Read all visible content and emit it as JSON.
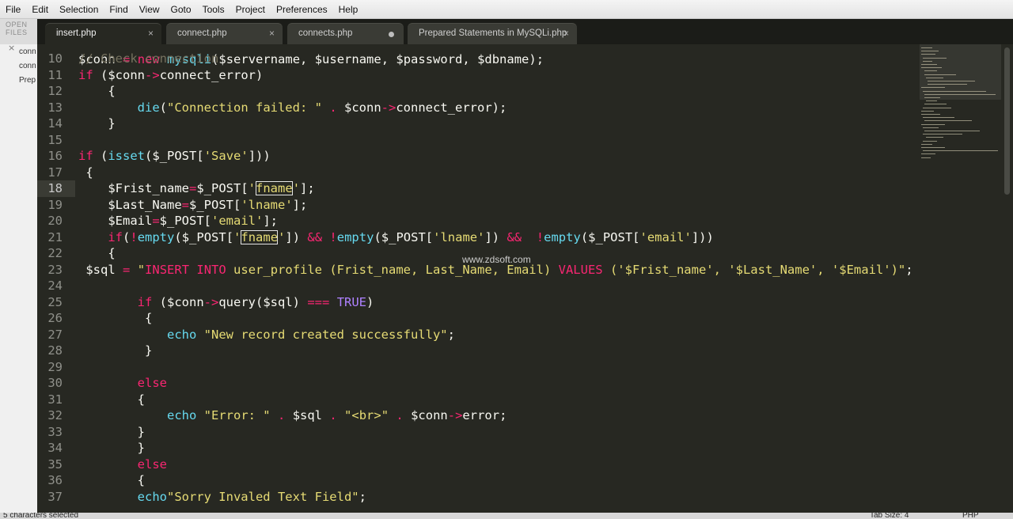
{
  "menu": [
    "File",
    "Edit",
    "Selection",
    "Find",
    "View",
    "Goto",
    "Tools",
    "Project",
    "Preferences",
    "Help"
  ],
  "sidebar": {
    "title": "OPEN FILES",
    "files": [
      "conn",
      "conn",
      "Prep"
    ]
  },
  "tabs": [
    {
      "label": "insert.php",
      "state": "active",
      "icon": "close-icon"
    },
    {
      "label": "connect.php",
      "state": "inactive",
      "icon": "close-icon"
    },
    {
      "label": "connects.php",
      "state": "inactive",
      "icon": "unsaved-dot-icon"
    },
    {
      "label": "Prepared Statements in MySQLi.php",
      "state": "inactive",
      "icon": "close-icon"
    }
  ],
  "editor": {
    "current_line": 18,
    "lines": [
      {
        "n": "10",
        "text": "// Check connection"
      },
      {
        "n": "11",
        "text": "if ($conn->connect_error)"
      },
      {
        "n": "12",
        "text": "    {"
      },
      {
        "n": "13",
        "text": "        die(\"Connection failed: \" . $conn->connect_error);"
      },
      {
        "n": "14",
        "text": "    }"
      },
      {
        "n": "15",
        "text": ""
      },
      {
        "n": "16",
        "text": "if (isset($_POST['Save']))"
      },
      {
        "n": "17",
        "text": " {"
      },
      {
        "n": "18",
        "text": "    $Frist_name=$_POST['fname'];"
      },
      {
        "n": "19",
        "text": "    $Last_Name=$_POST['lname'];"
      },
      {
        "n": "20",
        "text": "    $Email=$_POST['email'];"
      },
      {
        "n": "21",
        "text": "    if(!empty($_POST['fname']) && !empty($_POST['lname']) &&  !empty($_POST['email']))"
      },
      {
        "n": "22",
        "text": "    {"
      },
      {
        "n": "23",
        "text": " $sql = \"INSERT INTO user_profile (Frist_name, Last_Name, Email) VALUES ('$Frist_name', '$Last_Name', '$Email')\";"
      },
      {
        "n": "24",
        "text": ""
      },
      {
        "n": "25",
        "text": "        if ($conn->query($sql) === TRUE)"
      },
      {
        "n": "26",
        "text": "         {"
      },
      {
        "n": "27",
        "text": "            echo \"New record created successfully\";"
      },
      {
        "n": "28",
        "text": "         }"
      },
      {
        "n": "29",
        "text": ""
      },
      {
        "n": "30",
        "text": "        else"
      },
      {
        "n": "31",
        "text": "        {"
      },
      {
        "n": "32",
        "text": "            echo \"Error: \" . $sql . \"<br>\" . $conn->error;"
      },
      {
        "n": "33",
        "text": "        }"
      },
      {
        "n": "34",
        "text": "        }"
      },
      {
        "n": "35",
        "text": "        else"
      },
      {
        "n": "36",
        "text": "        {"
      },
      {
        "n": "37",
        "text": "        echo\"Sorry Invaled Text Field\";"
      }
    ]
  },
  "watermark": "www.zdsoft.com",
  "status": {
    "selection": "5 characters selected",
    "tab_size": "Tab Size: 4",
    "syntax": "PHP"
  },
  "colors": {
    "background": "#272822",
    "keyword": "#f92672",
    "function": "#66d9ef",
    "string": "#e6db74",
    "comment": "#75715e",
    "constant": "#ae81ff"
  }
}
